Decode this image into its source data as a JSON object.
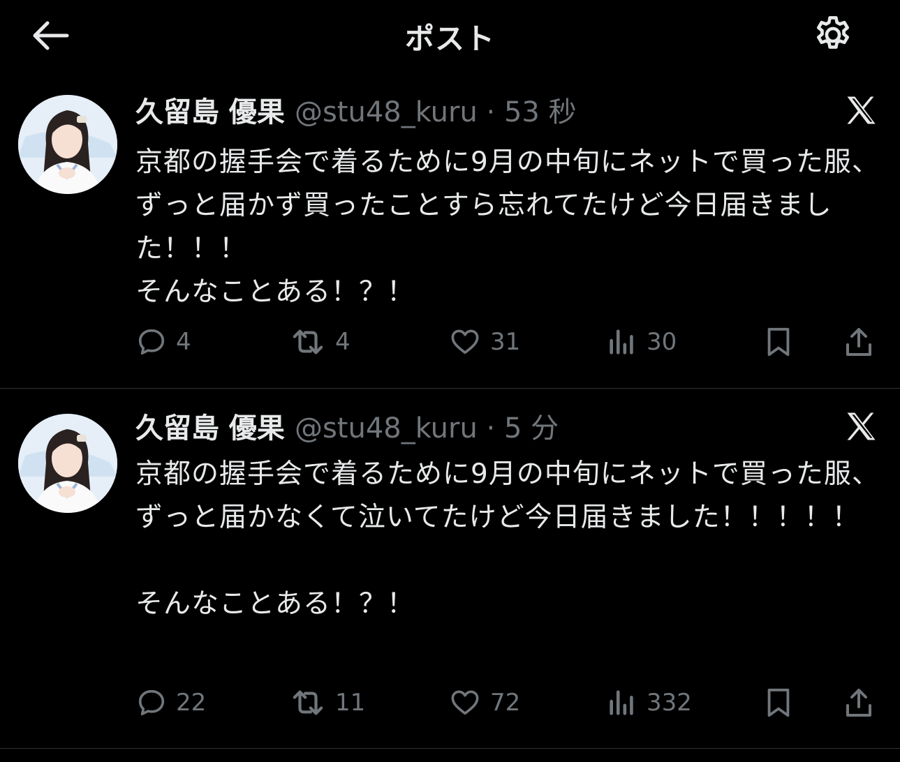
{
  "header": {
    "title": "ポスト",
    "back_icon": "arrow-left-icon",
    "settings_icon": "gear-icon"
  },
  "colors": {
    "background": "#000000",
    "primary_text": "#e7e9ea",
    "secondary_text": "#71767b",
    "divider": "#2f3336"
  },
  "tweets": [
    {
      "display_name": "久留島 優果",
      "handle": "@stu48_kuru",
      "separator": "·",
      "time": "53 秒",
      "text": "京都の握手会で着るために9月の中旬にネットで買った服、ずっと届かず買ったことすら忘れてたけど今日届きました！！！\nそんなことある！？！",
      "replies": "4",
      "reposts": "4",
      "likes": "31",
      "views": "30"
    },
    {
      "display_name": "久留島 優果",
      "handle": "@stu48_kuru",
      "separator": "·",
      "time": "5 分",
      "text": "京都の握手会で着るために9月の中旬にネットで買った服、ずっと届かなくて泣いてたけど今日届きました！！！！！\n\nそんなことある！？！",
      "replies": "22",
      "reposts": "11",
      "likes": "72",
      "views": "332"
    }
  ]
}
